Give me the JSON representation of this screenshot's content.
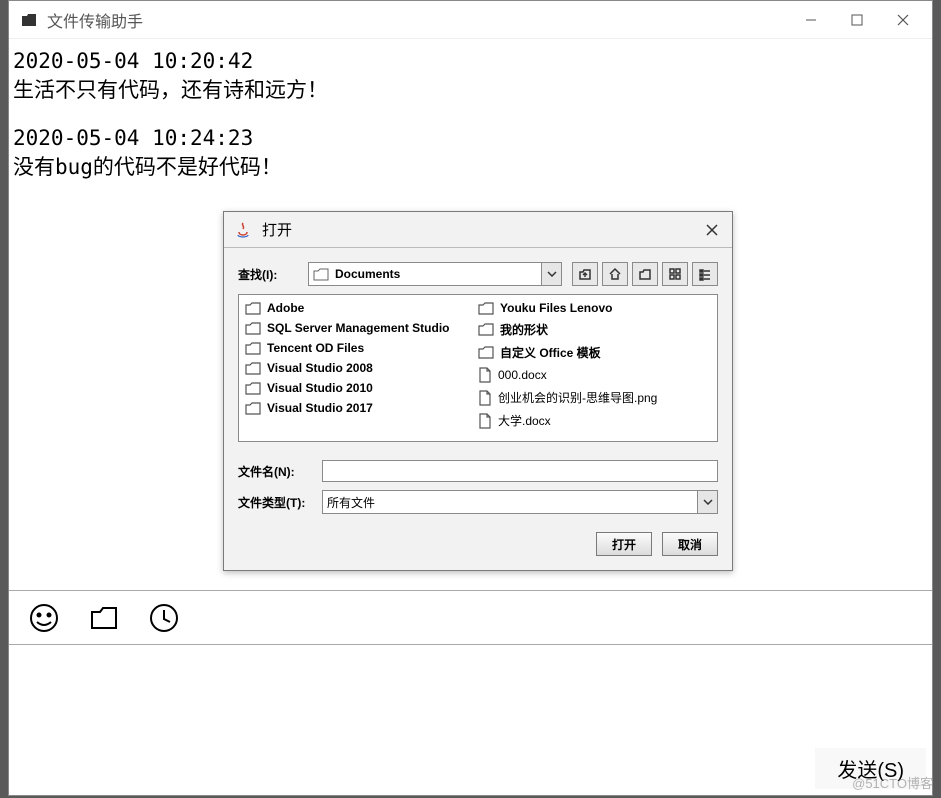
{
  "window": {
    "title": "文件传输助手"
  },
  "messages": [
    {
      "timestamp": "2020-05-04 10:20:42",
      "text": "生活不只有代码，还有诗和远方！"
    },
    {
      "timestamp": "2020-05-04 10:24:23",
      "text": "没有bug的代码不是好代码！"
    }
  ],
  "send_button": "发送(S)",
  "watermark": "@51CTO博客",
  "file_dialog": {
    "title": "打开",
    "lookin_label": "查找(I):",
    "current_folder": "Documents",
    "items_col1": [
      {
        "name": "Adobe",
        "type": "folder"
      },
      {
        "name": "SQL Server Management Studio",
        "type": "folder"
      },
      {
        "name": "Tencent OD Files",
        "type": "folder"
      },
      {
        "name": "Visual Studio 2008",
        "type": "folder"
      },
      {
        "name": "Visual Studio 2010",
        "type": "folder"
      },
      {
        "name": "Visual Studio 2017",
        "type": "folder"
      }
    ],
    "items_col2": [
      {
        "name": "Youku Files Lenovo",
        "type": "folder"
      },
      {
        "name": "我的形状",
        "type": "folder"
      },
      {
        "name": "自定义 Office 模板",
        "type": "folder"
      },
      {
        "name": "000.docx",
        "type": "file"
      },
      {
        "name": "创业机会的识别-思维导图.png",
        "type": "file"
      },
      {
        "name": "大学.docx",
        "type": "file"
      }
    ],
    "filename_label": "文件名(N):",
    "filename_value": "",
    "filetype_label": "文件类型(T):",
    "filetype_value": "所有文件",
    "open_btn": "打开",
    "cancel_btn": "取消"
  }
}
